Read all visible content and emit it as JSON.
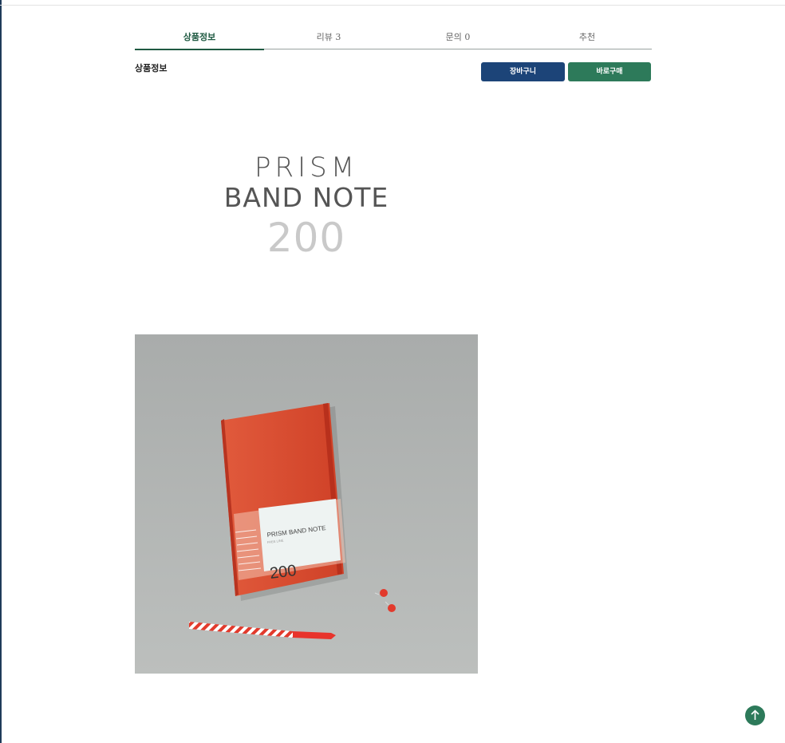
{
  "tabs": [
    {
      "label": "상품정보"
    },
    {
      "label": "리뷰 3"
    },
    {
      "label": "문의 0"
    },
    {
      "label": "추천"
    }
  ],
  "section": {
    "title": "상품정보"
  },
  "buttons": {
    "cart": "장바구니",
    "buy": "바로구매"
  },
  "hero": {
    "line1": "PRISM",
    "line2": "BAND NOTE",
    "number": "200"
  },
  "notebook": {
    "label_title": "PRISM BAND NOTE",
    "label_sub": "FREE LINE",
    "label_number": "200"
  },
  "colors": {
    "accent_green": "#2d7a5a",
    "accent_blue": "#1c4478",
    "notebook_red": "#d9472b",
    "background_gray": "#b4b7b5"
  },
  "icons": {
    "scroll_top": "arrow-up-icon"
  }
}
